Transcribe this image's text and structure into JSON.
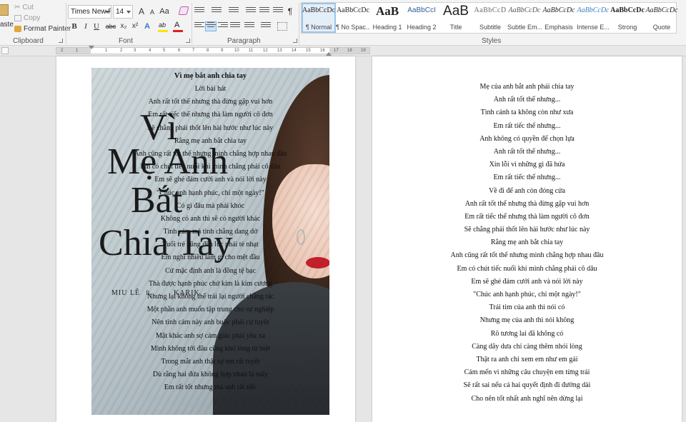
{
  "clipboard": {
    "paste_label": "aste",
    "cut_label": "Cut",
    "copy_label": "Copy",
    "format_painter_label": "Format Painter",
    "group_label": "Clipboard"
  },
  "font": {
    "name": "Times New Ro",
    "size": "14",
    "group_label": "Font",
    "grow_label": "A",
    "shrink_label": "A",
    "case_label": "Aa",
    "bold": "B",
    "italic": "I",
    "underline": "U",
    "strike": "abc",
    "subscript": "x₂",
    "superscript": "x²",
    "text_effects": "A",
    "highlight": "ab",
    "font_color": "A",
    "highlight_color": "#f7e600",
    "font_color_value": "#e02020"
  },
  "paragraph": {
    "group_label": "Paragraph",
    "pilcrow": "¶"
  },
  "styles": {
    "group_label": "Styles",
    "items": [
      {
        "preview": "AaBbCcDc",
        "name": "¶ Normal"
      },
      {
        "preview": "AaBbCcDc",
        "name": "¶ No Spac..."
      },
      {
        "preview": "AaB",
        "name": "Heading 1"
      },
      {
        "preview": "AaBbCcI",
        "name": "Heading 2"
      },
      {
        "preview": "AaB",
        "name": "Title"
      },
      {
        "preview": "AaBbCcD",
        "name": "Subtitle"
      },
      {
        "preview": "AaBbCcDc",
        "name": "Subtle Em..."
      },
      {
        "preview": "AaBbCcDc",
        "name": "Emphasis"
      },
      {
        "preview": "AaBbCcDc",
        "name": "Intense E..."
      },
      {
        "preview": "AaBbCcDc",
        "name": "Strong"
      },
      {
        "preview": "AaBbCcDc",
        "name": "Quote"
      }
    ]
  },
  "ruler": {
    "numbers": [
      "2",
      "1",
      "1",
      "2",
      "3",
      "4",
      "5",
      "6",
      "7",
      "8",
      "9",
      "10",
      "11",
      "12",
      "13",
      "14",
      "15",
      "16",
      "17",
      "18",
      "19"
    ]
  },
  "cover": {
    "title_line1": "Vì",
    "title_line2": "Mẹ Anh",
    "title_line3": "Bắt",
    "title_line4": "Chia Tay",
    "artist": "MIU LÊ",
    "ft": "ft.",
    "feat": "KARIK"
  },
  "left_page": {
    "title": "Vì mẹ bắt anh chia tay",
    "lines": [
      "Lời bài hát",
      "Anh rất tốt thế nhưng thà đừng gặp vui hơn",
      "Em rất tiếc thế nhưng thà làm người cô đơn",
      "Sẽ chẳng phải thốt lên hài hước như lúc này",
      "Rằng mẹ anh bắt chia tay",
      "Anh cũng rất tốt thế nhưng mình chẳng hợp nhau đâu",
      "Em có chút tiếc nuối khi mình chẳng phải cô dâu",
      "Em sẽ ghé đám cưới anh và nói lời này",
      "\"Chúc anh hạnh phúc, chỉ một ngày!\"",
      "Có gì đâu mà phải khóc",
      "Không có anh thì sẽ có người khác",
      "Tình cảm mà tình chẳng dang dở",
      "Tuổi trẻ cũng đến lúc phải tẻ nhạt",
      "Em nghĩ nhiều làm gì cho mệt đầu",
      "Cứ mặc định anh là đồng tệ bạc",
      "Thà được hạnh phúc chứ kim là kim cương",
      "Nhưng lại không thể trải lại người chẳng tác",
      "Một phần anh muốn tập trung cho sự nghiệp",
      "Nên tình cảm này anh buộc phải cự tuyệt",
      "Mặt khác anh sợ cảm giác phải yêu xa",
      "Mình không tới đâu cũng khó lòng từ biệt",
      "Trong mắt anh thật sự em rất tuyệt",
      "Dù rằng hai đứa không hợp nhau là mấy",
      "Em rất tốt nhưng mà anh rất tiếc"
    ]
  },
  "right_page": {
    "lines": [
      "Mẹ của anh bắt anh phải chia tay",
      "Anh rất tốt thế nhưng...",
      "Tình cảnh ta không còn như xưa",
      "Em rất tiếc thế nhưng...",
      "Anh không có quyền để chọn lựa",
      "Anh rất tốt thế nhưng...",
      "Xin lỗi vì những gì đã hứa",
      "Em rất tiếc thế nhưng...",
      "Về đi để anh còn đóng cửa",
      "Anh rất tốt thế nhưng thà đừng gặp vui hơn",
      "Em rất tiếc thế nhưng thà làm người cô đơn",
      "Sẽ chẳng phải thốt lên hài hước như lúc này",
      "Rằng mẹ anh bắt chia tay",
      "Anh cũng rất tốt thế nhưng mình chẳng hợp nhau đâu",
      "Em có chút tiếc nuối khi mình chẳng phải cô dâu",
      "Em sẽ ghé đám cưới anh và nói lời này",
      "\"Chúc anh hạnh phúc, chỉ một ngày!\"",
      "Trái tim của anh thì nói có",
      "Nhưng mẹ của anh thì nói không",
      "Rõ tương lai đã không có",
      "Càng dây dưa chỉ càng thêm nhói lòng",
      "Thật ra anh chỉ xem em như em gái",
      "Cám mến vì những câu chuyện em từng trải",
      "Sẽ rất sai nếu cả hai quyết định đi đường dài",
      "Cho nên tốt nhất anh nghĩ nên dừng lại"
    ]
  }
}
